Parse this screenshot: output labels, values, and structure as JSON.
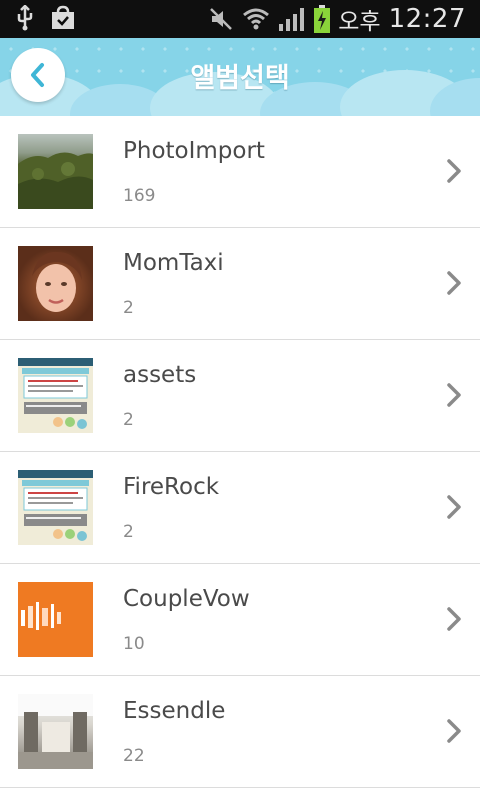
{
  "status_bar": {
    "ampm": "오후",
    "time": "12:27",
    "icons": [
      "usb-icon",
      "shopping-bag-icon",
      "mute-icon",
      "wifi-icon",
      "signal-icon",
      "battery-charging-icon"
    ]
  },
  "header": {
    "title": "앨범선택",
    "back_icon": "chevron-left-icon",
    "colors": {
      "background": "#86d4e8",
      "accent": "#3fb6d6"
    }
  },
  "albums": [
    {
      "name": "PhotoImport",
      "count": "169",
      "thumb": "forest-photo"
    },
    {
      "name": "MomTaxi",
      "count": "2",
      "thumb": "girl-portrait"
    },
    {
      "name": "assets",
      "count": "2",
      "thumb": "app-screenshot"
    },
    {
      "name": "FireRock",
      "count": "2",
      "thumb": "app-screenshot"
    },
    {
      "name": "CoupleVow",
      "count": "10",
      "thumb": "orange-graphic"
    },
    {
      "name": "Essendle",
      "count": "22",
      "thumb": "room-photo"
    }
  ]
}
